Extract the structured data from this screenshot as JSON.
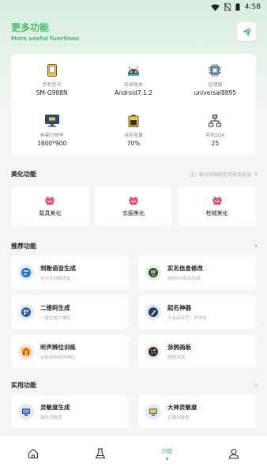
{
  "statusbar": {
    "time": "4:58"
  },
  "header": {
    "title": "更多功能",
    "subtitle": "More useful functions"
  },
  "device_info": [
    {
      "label": "手机型号",
      "value": "SM-G988N",
      "icon": "phone-icon"
    },
    {
      "label": "安卓版本",
      "value": "Android7.1.2",
      "icon": "android-icon"
    },
    {
      "label": "处理器",
      "value": "universal8895",
      "icon": "cpu-icon"
    },
    {
      "label": "屏幕分辨率",
      "value": "1600*900",
      "icon": "monitor-icon"
    },
    {
      "label": "当前电量",
      "value": "70%",
      "icon": "battery-icon"
    },
    {
      "label": "手机SDK",
      "value": "25",
      "icon": "sdk-icon"
    }
  ],
  "beautify": {
    "title": "美化功能",
    "note": "注：部分特殊机型可能会无效",
    "items": [
      {
        "label": "载具美化",
        "icon": "vehicle-icon"
      },
      {
        "label": "衣服美化",
        "icon": "clothes-icon"
      },
      {
        "label": "枪械美化",
        "icon": "gun-icon"
      }
    ]
  },
  "recommended": {
    "title": "推荐功能",
    "items": [
      {
        "name": "到账语音生成",
        "desc": "支付宝到账语音",
        "icon": "payment-voice-icon",
        "color": "#2a6fc9"
      },
      {
        "name": "实名信息修改",
        "desc": "修改QQ实名信息",
        "icon": "id-edit-icon",
        "color": "#3a4a3a"
      },
      {
        "name": "二维码生成",
        "desc": "一键生成二维码",
        "icon": "qrcode-icon",
        "color": "#2d5aa0"
      },
      {
        "name": "起名神器",
        "desc": "不会起名字？不用怕",
        "icon": "naming-icon",
        "color": "#1f3a7a"
      },
      {
        "name": "听声辨位训练",
        "desc": "训练你的听声辨位",
        "icon": "sound-training-icon",
        "color": "#c0392b"
      },
      {
        "name": "涂鸦画板",
        "desc": "随意涂鸦",
        "icon": "paint-board-icon",
        "color": "#2c2c2c"
      }
    ]
  },
  "practical": {
    "title": "实用功能",
    "items": [
      {
        "name": "灵敏度生成",
        "desc": "最优灵敏度",
        "icon": "sensitivity-icon",
        "color": "#2a3f6a"
      },
      {
        "name": "大神灵敏度",
        "desc": "主播灵敏度",
        "icon": "pro-sensitivity-icon",
        "color": "#2d5aa0"
      }
    ]
  },
  "nav": {
    "features_label": "功能",
    "accent": "#4cbb6c"
  }
}
